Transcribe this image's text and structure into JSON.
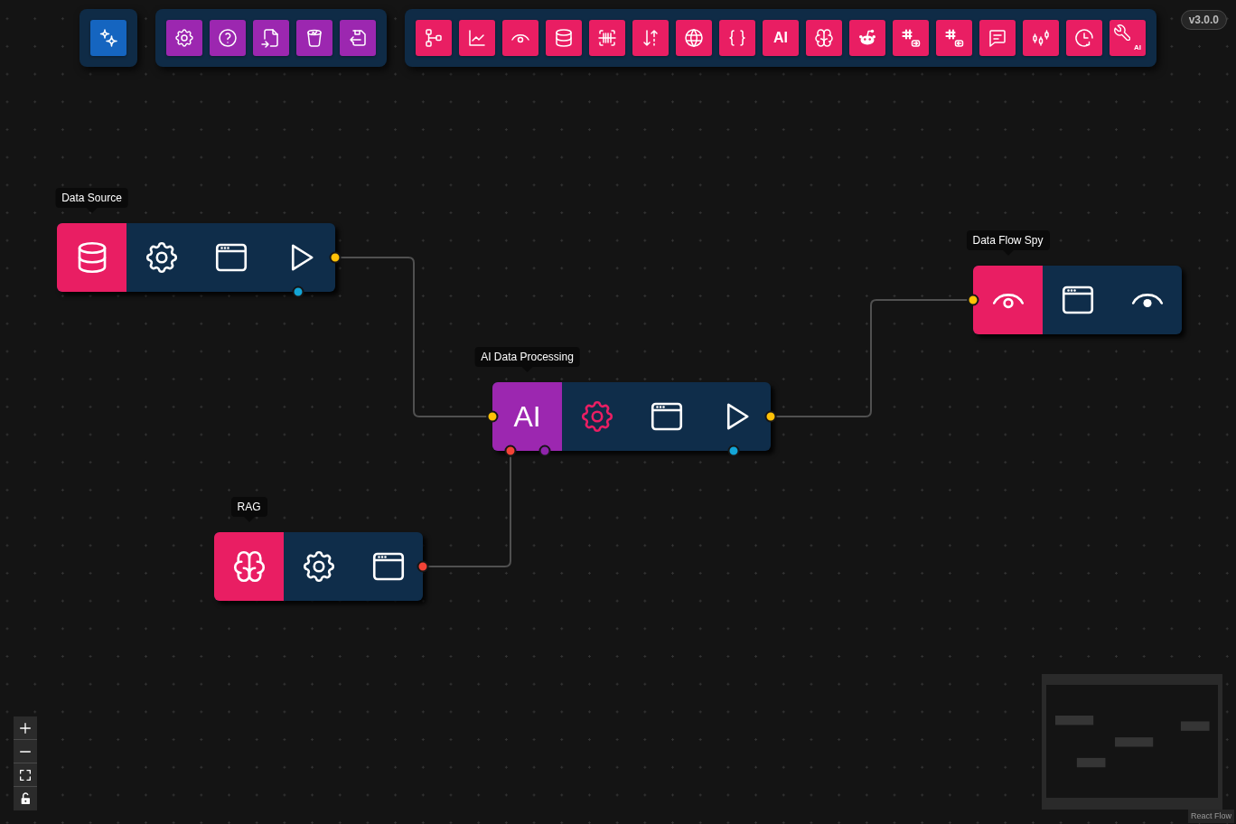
{
  "toolbar": {
    "groups": [
      {
        "color": "#1565c0",
        "buttons": [
          {
            "kind": "sparkles"
          }
        ]
      },
      {
        "color": "#9c27b0",
        "buttons": [
          {
            "kind": "settings"
          },
          {
            "kind": "help"
          },
          {
            "kind": "import"
          },
          {
            "kind": "bucket"
          },
          {
            "kind": "save"
          }
        ]
      },
      {
        "color": "#e91e63",
        "buttons": [
          {
            "kind": "flowchart"
          },
          {
            "kind": "chart"
          },
          {
            "kind": "eye"
          },
          {
            "kind": "database"
          },
          {
            "kind": "scan"
          },
          {
            "kind": "sort"
          },
          {
            "kind": "globe"
          },
          {
            "kind": "braces"
          },
          {
            "kind": "text",
            "label": "AI"
          },
          {
            "kind": "brain"
          },
          {
            "kind": "alien"
          },
          {
            "kind": "hashout"
          },
          {
            "kind": "hashin"
          },
          {
            "kind": "chat"
          },
          {
            "kind": "candles"
          },
          {
            "kind": "clock"
          },
          {
            "kind": "wrench",
            "label": "AI"
          }
        ]
      }
    ]
  },
  "version": "v3.0.0",
  "canvas": {
    "nodes": [
      {
        "label": "Data Source",
        "kind": "database",
        "color": "#e91e63",
        "actions": [
          {
            "kind": "settings",
            "highlighted": false
          },
          {
            "kind": "window",
            "highlighted": false
          },
          {
            "kind": "play",
            "highlighted": false
          }
        ],
        "handles": [
          {
            "color": "#ffc107"
          },
          {
            "color": "#13a5d6"
          }
        ]
      },
      {
        "label": "Data Flow Spy",
        "kind": "eye",
        "color": "#e91e63",
        "actions": [
          {
            "kind": "window",
            "highlighted": false
          },
          {
            "kind": "watch",
            "highlighted": false
          }
        ],
        "handles": [
          {
            "color": "#ffc107"
          }
        ]
      },
      {
        "label": "AI Data Processing",
        "kind": "text",
        "tile_text": "AI",
        "color": "#9c27b0",
        "actions": [
          {
            "kind": "settings",
            "highlighted": true
          },
          {
            "kind": "window",
            "highlighted": false
          },
          {
            "kind": "play",
            "highlighted": false
          }
        ],
        "handles": [
          {
            "color": "#ffc107"
          },
          {
            "color": "#ffc107"
          },
          {
            "color": "#f44336"
          },
          {
            "color": "#8e24aa"
          },
          {
            "color": "#13a5d6"
          }
        ]
      },
      {
        "label": "RAG",
        "kind": "brain",
        "color": "#e91e63",
        "actions": [
          {
            "kind": "settings",
            "highlighted": false
          },
          {
            "kind": "window",
            "highlighted": false
          }
        ],
        "handles": [
          {
            "color": "#f44336"
          }
        ]
      }
    ]
  },
  "controls": [
    {
      "kind": "zoomin"
    },
    {
      "kind": "zoomout"
    },
    {
      "kind": "fit"
    },
    {
      "kind": "lock",
      "locked": false
    }
  ],
  "attribution": "React Flow"
}
